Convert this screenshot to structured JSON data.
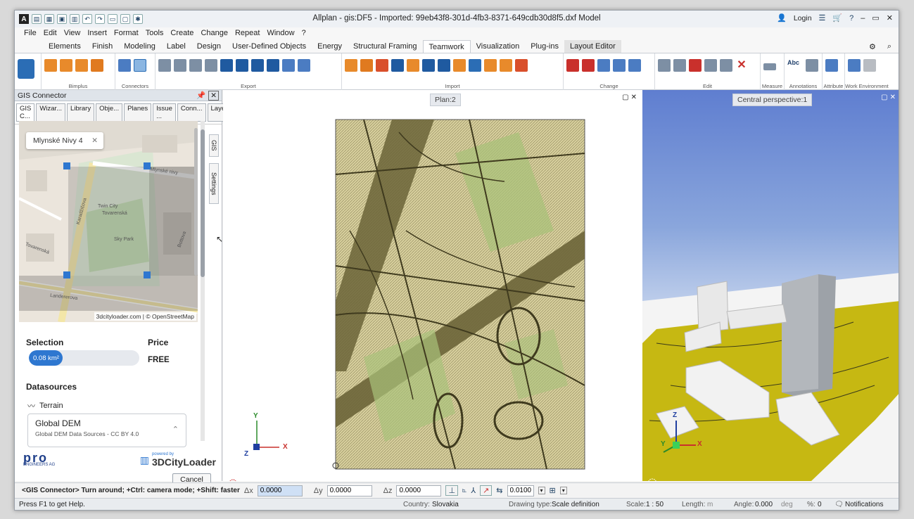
{
  "window": {
    "app_icon": "A",
    "title": "Allplan - gis:DF5 - Imported: 99eb43f8-301d-4fb3-8371-649cdb30d8f5.dxf Model",
    "login": "Login"
  },
  "menu": [
    "File",
    "Edit",
    "View",
    "Insert",
    "Format",
    "Tools",
    "Create",
    "Change",
    "Repeat",
    "Window",
    "?"
  ],
  "ribbon_tabs": [
    "Elements",
    "Finish",
    "Modeling",
    "Label",
    "Design",
    "User-Defined Objects",
    "Energy",
    "Structural Framing",
    "Teamwork",
    "Visualization",
    "Plug-ins",
    "Layout Editor"
  ],
  "ribbon_groups": [
    "Bimplus",
    "Connectors",
    "Export",
    "Import",
    "Change",
    "Edit",
    "Measure",
    "Annotations",
    "Attribute",
    "Work Environment"
  ],
  "ribbon_icon_labels": {
    "abc": "Abc"
  },
  "panel": {
    "title": "GIS Connector",
    "tabs": [
      "GIS C...",
      "Wizar...",
      "Library",
      "Obje...",
      "Planes",
      "Issue ...",
      "Conn...",
      "Layers"
    ],
    "side_tabs": [
      "GIS",
      "Settings"
    ],
    "map_search": "Mlynské Nivy 4",
    "map_attribution": "3dcityloader.com | © OpenStreetMap",
    "map_labels": [
      "Mlynské nivy",
      "Twin City",
      "Tovarenská",
      "Sky Park",
      "Landererova",
      "Karadžičova",
      "Bottova",
      "Tovarenská"
    ],
    "selection_label": "Selection",
    "price_label": "Price",
    "selection_value": "0.08 km²",
    "price_value": "FREE",
    "datasources_label": "Datasources",
    "terrain_label": "Terrain",
    "dem_title": "Global DEM",
    "dem_sub": "Global DEM Data Sources - CC BY 4.0",
    "logo_left": "pro",
    "logo_left_sub": "ENGINEERS AG",
    "logo_right_small": "powered by",
    "logo_right": "3DCityLoader",
    "cancel": "Cancel"
  },
  "plan_view": {
    "label": "Plan:2",
    "axes": [
      "Y",
      "X",
      "Z"
    ]
  },
  "persp_view": {
    "label": "Central perspective:1",
    "axes": [
      "Z",
      "Y",
      "X"
    ]
  },
  "command": {
    "prompt": "<GIS Connector> Turn around; +Ctrl: camera mode; +Shift: faster",
    "dx_label": "Δx",
    "dx": "0.0000",
    "dy_label": "Δy",
    "dy": "0.0000",
    "dz_label": "Δz",
    "dz": "0.0000",
    "snap_value": "0.0100"
  },
  "status": {
    "help": "Press F1 to get Help.",
    "country_label": "Country:",
    "country": "Slovakia",
    "drawing_type_label": "Drawing type:",
    "drawing_type": "Scale definition",
    "scale_label": "Scale:",
    "scale": "1 : 50",
    "length_label": "Length:",
    "length_unit": "m",
    "angle_label": "Angle:",
    "angle": "0.000",
    "angle_unit": "deg",
    "percent_label": "%:",
    "percent": "0",
    "notifications": "Notifications"
  }
}
